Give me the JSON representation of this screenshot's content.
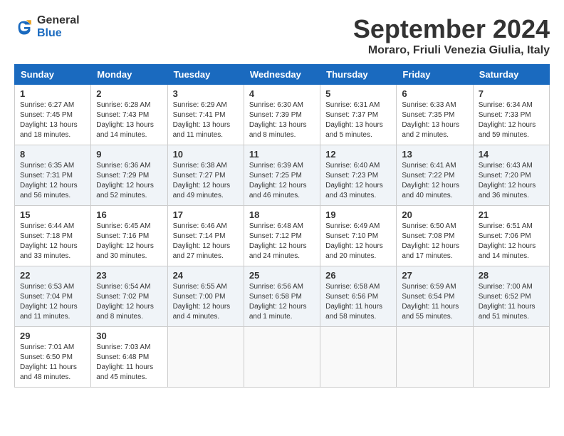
{
  "header": {
    "logo_general": "General",
    "logo_blue": "Blue",
    "month_year": "September 2024",
    "location": "Moraro, Friuli Venezia Giulia, Italy"
  },
  "weekdays": [
    "Sunday",
    "Monday",
    "Tuesday",
    "Wednesday",
    "Thursday",
    "Friday",
    "Saturday"
  ],
  "weeks": [
    [
      {
        "day": "1",
        "lines": [
          "Sunrise: 6:27 AM",
          "Sunset: 7:45 PM",
          "Daylight: 13 hours",
          "and 18 minutes."
        ]
      },
      {
        "day": "2",
        "lines": [
          "Sunrise: 6:28 AM",
          "Sunset: 7:43 PM",
          "Daylight: 13 hours",
          "and 14 minutes."
        ]
      },
      {
        "day": "3",
        "lines": [
          "Sunrise: 6:29 AM",
          "Sunset: 7:41 PM",
          "Daylight: 13 hours",
          "and 11 minutes."
        ]
      },
      {
        "day": "4",
        "lines": [
          "Sunrise: 6:30 AM",
          "Sunset: 7:39 PM",
          "Daylight: 13 hours",
          "and 8 minutes."
        ]
      },
      {
        "day": "5",
        "lines": [
          "Sunrise: 6:31 AM",
          "Sunset: 7:37 PM",
          "Daylight: 13 hours",
          "and 5 minutes."
        ]
      },
      {
        "day": "6",
        "lines": [
          "Sunrise: 6:33 AM",
          "Sunset: 7:35 PM",
          "Daylight: 13 hours",
          "and 2 minutes."
        ]
      },
      {
        "day": "7",
        "lines": [
          "Sunrise: 6:34 AM",
          "Sunset: 7:33 PM",
          "Daylight: 12 hours",
          "and 59 minutes."
        ]
      }
    ],
    [
      {
        "day": "8",
        "lines": [
          "Sunrise: 6:35 AM",
          "Sunset: 7:31 PM",
          "Daylight: 12 hours",
          "and 56 minutes."
        ]
      },
      {
        "day": "9",
        "lines": [
          "Sunrise: 6:36 AM",
          "Sunset: 7:29 PM",
          "Daylight: 12 hours",
          "and 52 minutes."
        ]
      },
      {
        "day": "10",
        "lines": [
          "Sunrise: 6:38 AM",
          "Sunset: 7:27 PM",
          "Daylight: 12 hours",
          "and 49 minutes."
        ]
      },
      {
        "day": "11",
        "lines": [
          "Sunrise: 6:39 AM",
          "Sunset: 7:25 PM",
          "Daylight: 12 hours",
          "and 46 minutes."
        ]
      },
      {
        "day": "12",
        "lines": [
          "Sunrise: 6:40 AM",
          "Sunset: 7:23 PM",
          "Daylight: 12 hours",
          "and 43 minutes."
        ]
      },
      {
        "day": "13",
        "lines": [
          "Sunrise: 6:41 AM",
          "Sunset: 7:22 PM",
          "Daylight: 12 hours",
          "and 40 minutes."
        ]
      },
      {
        "day": "14",
        "lines": [
          "Sunrise: 6:43 AM",
          "Sunset: 7:20 PM",
          "Daylight: 12 hours",
          "and 36 minutes."
        ]
      }
    ],
    [
      {
        "day": "15",
        "lines": [
          "Sunrise: 6:44 AM",
          "Sunset: 7:18 PM",
          "Daylight: 12 hours",
          "and 33 minutes."
        ]
      },
      {
        "day": "16",
        "lines": [
          "Sunrise: 6:45 AM",
          "Sunset: 7:16 PM",
          "Daylight: 12 hours",
          "and 30 minutes."
        ]
      },
      {
        "day": "17",
        "lines": [
          "Sunrise: 6:46 AM",
          "Sunset: 7:14 PM",
          "Daylight: 12 hours",
          "and 27 minutes."
        ]
      },
      {
        "day": "18",
        "lines": [
          "Sunrise: 6:48 AM",
          "Sunset: 7:12 PM",
          "Daylight: 12 hours",
          "and 24 minutes."
        ]
      },
      {
        "day": "19",
        "lines": [
          "Sunrise: 6:49 AM",
          "Sunset: 7:10 PM",
          "Daylight: 12 hours",
          "and 20 minutes."
        ]
      },
      {
        "day": "20",
        "lines": [
          "Sunrise: 6:50 AM",
          "Sunset: 7:08 PM",
          "Daylight: 12 hours",
          "and 17 minutes."
        ]
      },
      {
        "day": "21",
        "lines": [
          "Sunrise: 6:51 AM",
          "Sunset: 7:06 PM",
          "Daylight: 12 hours",
          "and 14 minutes."
        ]
      }
    ],
    [
      {
        "day": "22",
        "lines": [
          "Sunrise: 6:53 AM",
          "Sunset: 7:04 PM",
          "Daylight: 12 hours",
          "and 11 minutes."
        ]
      },
      {
        "day": "23",
        "lines": [
          "Sunrise: 6:54 AM",
          "Sunset: 7:02 PM",
          "Daylight: 12 hours",
          "and 8 minutes."
        ]
      },
      {
        "day": "24",
        "lines": [
          "Sunrise: 6:55 AM",
          "Sunset: 7:00 PM",
          "Daylight: 12 hours",
          "and 4 minutes."
        ]
      },
      {
        "day": "25",
        "lines": [
          "Sunrise: 6:56 AM",
          "Sunset: 6:58 PM",
          "Daylight: 12 hours",
          "and 1 minute."
        ]
      },
      {
        "day": "26",
        "lines": [
          "Sunrise: 6:58 AM",
          "Sunset: 6:56 PM",
          "Daylight: 11 hours",
          "and 58 minutes."
        ]
      },
      {
        "day": "27",
        "lines": [
          "Sunrise: 6:59 AM",
          "Sunset: 6:54 PM",
          "Daylight: 11 hours",
          "and 55 minutes."
        ]
      },
      {
        "day": "28",
        "lines": [
          "Sunrise: 7:00 AM",
          "Sunset: 6:52 PM",
          "Daylight: 11 hours",
          "and 51 minutes."
        ]
      }
    ],
    [
      {
        "day": "29",
        "lines": [
          "Sunrise: 7:01 AM",
          "Sunset: 6:50 PM",
          "Daylight: 11 hours",
          "and 48 minutes."
        ]
      },
      {
        "day": "30",
        "lines": [
          "Sunrise: 7:03 AM",
          "Sunset: 6:48 PM",
          "Daylight: 11 hours",
          "and 45 minutes."
        ]
      },
      {
        "day": "",
        "lines": []
      },
      {
        "day": "",
        "lines": []
      },
      {
        "day": "",
        "lines": []
      },
      {
        "day": "",
        "lines": []
      },
      {
        "day": "",
        "lines": []
      }
    ]
  ]
}
